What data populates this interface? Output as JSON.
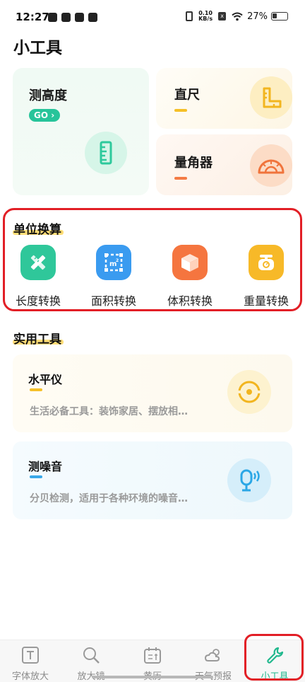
{
  "status_bar": {
    "time": "12:27",
    "net_speed_value": "0.10",
    "net_speed_unit": "KB/s",
    "battery": "27%"
  },
  "page": {
    "title": "小工具"
  },
  "top_tools": {
    "height": {
      "title": "测高度",
      "go": "GO"
    },
    "ruler": {
      "title": "直尺"
    },
    "angle": {
      "title": "量角器"
    }
  },
  "unit_conversion": {
    "title": "单位换算",
    "items": [
      {
        "label": "长度转换",
        "icon": "pencil-ruler-icon",
        "color": "#2fc79a"
      },
      {
        "label": "面积转换",
        "icon": "area-m2-icon",
        "color": "#3a9bf0"
      },
      {
        "label": "体积转换",
        "icon": "cube-icon",
        "color": "#f5753f"
      },
      {
        "label": "重量转换",
        "icon": "scale-icon",
        "color": "#f7b928"
      }
    ]
  },
  "practical_tools": {
    "title": "实用工具",
    "items": [
      {
        "name": "水平仪",
        "desc": "生活必备工具：装饰家居、摆放相…"
      },
      {
        "name": "测噪音",
        "desc": "分贝检测，适用于各种环境的噪音…"
      }
    ]
  },
  "bottom_nav": {
    "items": [
      {
        "label": "字体放大",
        "icon": "text-icon"
      },
      {
        "label": "放大镜",
        "icon": "magnifier-icon"
      },
      {
        "label": "黄历",
        "icon": "calendar-icon"
      },
      {
        "label": "天气预报",
        "icon": "weather-icon"
      },
      {
        "label": "小工具",
        "icon": "wrench-icon",
        "active": true
      }
    ]
  },
  "colors": {
    "accent_green": "#20b88d",
    "highlight_red": "#e21f26"
  }
}
